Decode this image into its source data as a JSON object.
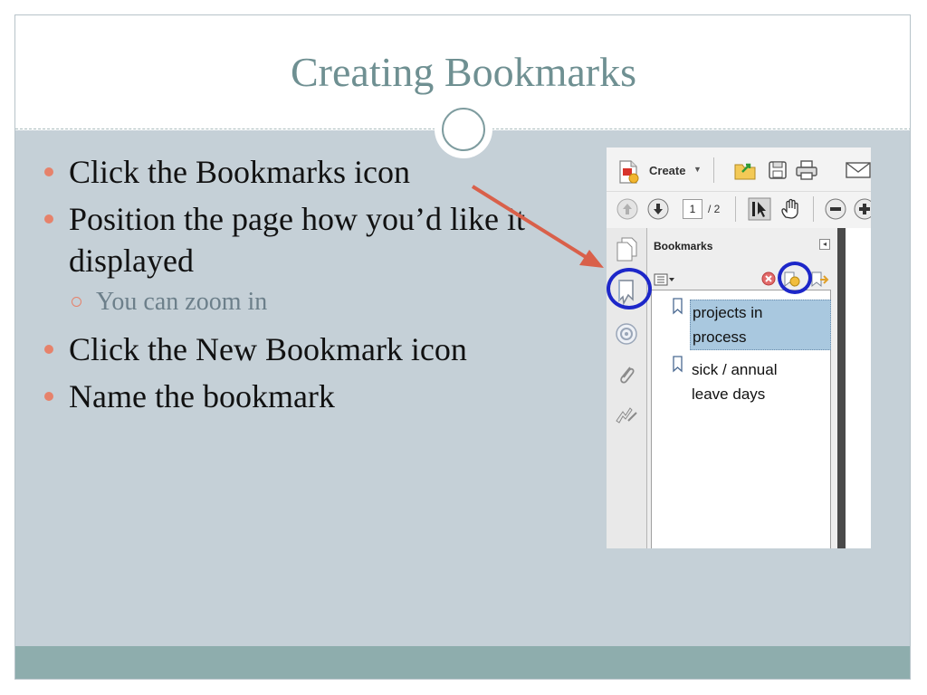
{
  "slide": {
    "title": "Creating Bookmarks",
    "bullets": [
      {
        "text": "Click the Bookmarks icon"
      },
      {
        "text": "Position the page how you’d like it displayed"
      },
      {
        "text": "You can zoom in",
        "level": 2
      },
      {
        "text": "Click the New Bookmark icon"
      },
      {
        "text": "Name the bookmark"
      }
    ],
    "colors": {
      "title": "#6f9092",
      "bullet_marker": "#e6826b",
      "content_bg": "#c5d0d7",
      "footer_bar": "#8eadad",
      "arrow": "#d9604a",
      "highlight_circle": "#1d27c9"
    }
  },
  "screenshot": {
    "toolbar": {
      "create_label": "Create",
      "create_dropdown_icon": "caret-down-icon",
      "icons": [
        "create-pdf-icon",
        "open-folder-icon",
        "save-icon",
        "print-icon",
        "email-icon"
      ]
    },
    "navbar": {
      "current_page": "1",
      "page_total": "/ 2",
      "icons": [
        "previous-page-icon",
        "next-page-icon",
        "select-tool-icon",
        "hand-tool-icon",
        "zoom-out-icon",
        "zoom-in-icon"
      ]
    },
    "left_tools": [
      "pages-icon",
      "bookmarks-icon",
      "signatures-icon",
      "attachments-icon",
      "sign-icon"
    ],
    "panel": {
      "title": "Bookmarks",
      "collapse_icon": "collapse-panel-icon",
      "options_icon": "bookmark-options-icon",
      "delete_icon": "delete-bookmark-icon",
      "new_bookmark_icon": "new-bookmark-icon",
      "expand_icon": "expand-bookmark-icon",
      "bookmarks": [
        {
          "line1": "projects in",
          "line2": "process",
          "selected": true
        },
        {
          "line1": "sick / annual",
          "line2": "leave days",
          "selected": false
        }
      ]
    }
  }
}
